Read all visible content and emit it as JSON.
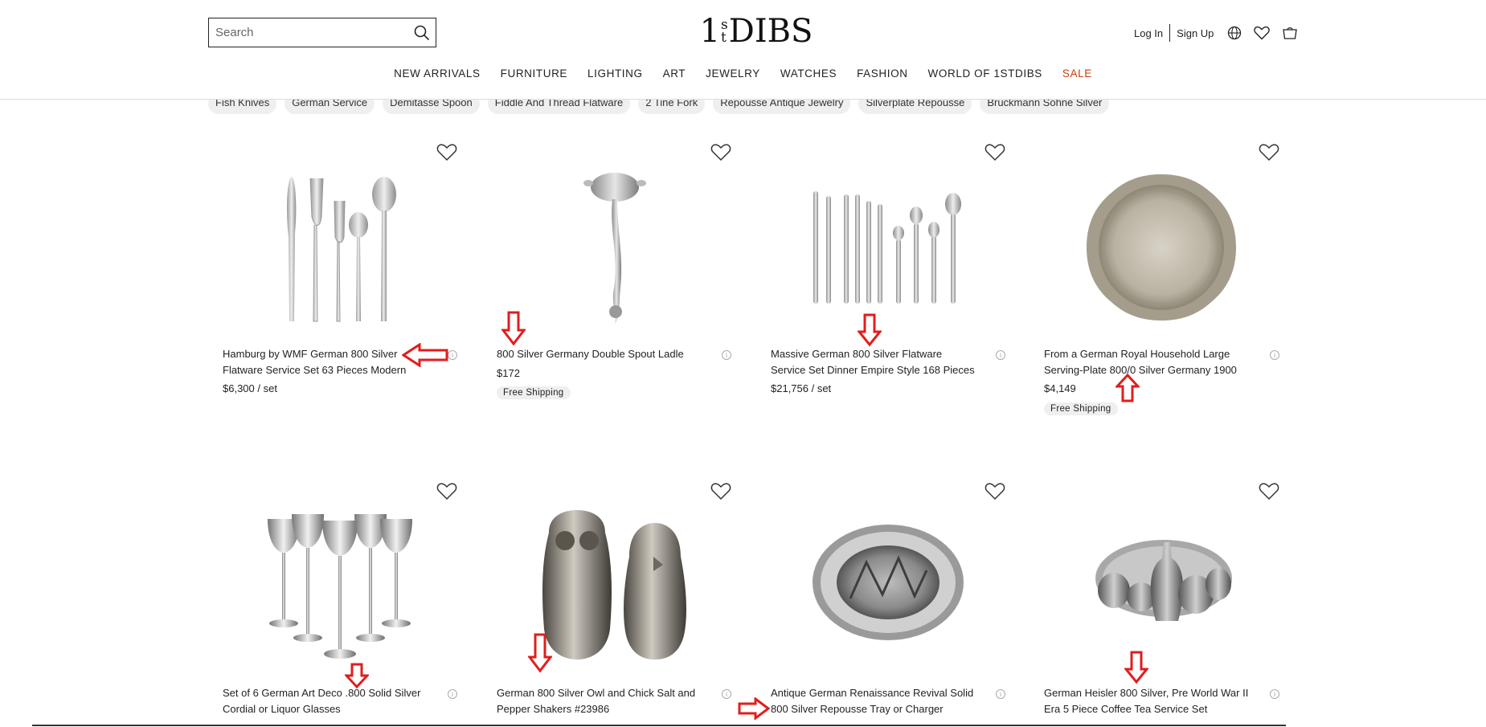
{
  "header": {
    "search_placeholder": "Search",
    "logo_left": "1",
    "logo_sup_top": "s",
    "logo_sup_bottom": "t",
    "logo_right": "DIBS",
    "login": "Log In",
    "signup": "Sign Up"
  },
  "nav": [
    "NEW ARRIVALS",
    "FURNITURE",
    "LIGHTING",
    "ART",
    "JEWELRY",
    "WATCHES",
    "FASHION",
    "WORLD OF 1STDIBS",
    "SALE"
  ],
  "chips": [
    "Fish Knives",
    "German Service",
    "Demitasse Spoon",
    "Fiddle And Thread Flatware",
    "2 Tine Fork",
    "Repousse Antique Jewelry",
    "Silverplate Repousse",
    "Bruckmann Sohne Silver"
  ],
  "products": [
    {
      "title": "Hamburg by WMF German 800 Silver Flatware Service Set 63 Pieces Modern",
      "price": "$6,300 / set",
      "badge": ""
    },
    {
      "title": "800 Silver Germany Double Spout Ladle",
      "price": "$172",
      "badge": "Free Shipping"
    },
    {
      "title": "Massive German 800 Silver Flatware Service Set Dinner Empire Style 168 Pieces",
      "price": "$21,756 / set",
      "badge": ""
    },
    {
      "title": "From a German Royal Household Large Serving-Plate 800/0 Silver Germany 1900",
      "price": "$4,149",
      "badge": "Free Shipping"
    },
    {
      "title": "Set of 6 German Art Deco .800 Solid Silver Cordial or Liquor Glasses",
      "price": "",
      "badge": ""
    },
    {
      "title": "German 800 Silver Owl and Chick Salt and Pepper Shakers #23986",
      "price": "",
      "badge": ""
    },
    {
      "title": "Antique German Renaissance Revival Solid 800 Silver Repousse Tray or Charger",
      "price": "",
      "badge": ""
    },
    {
      "title": "German Heisler 800 Silver, Pre World War II Era 5 Piece Coffee Tea Service Set",
      "price": "",
      "badge": ""
    }
  ],
  "colors": {
    "accent_sale": "#c2410c",
    "annotation_arrow": "#e11d1d"
  },
  "icons": [
    "search-icon",
    "globe-icon",
    "heart-icon",
    "cart-icon",
    "info-icon"
  ]
}
